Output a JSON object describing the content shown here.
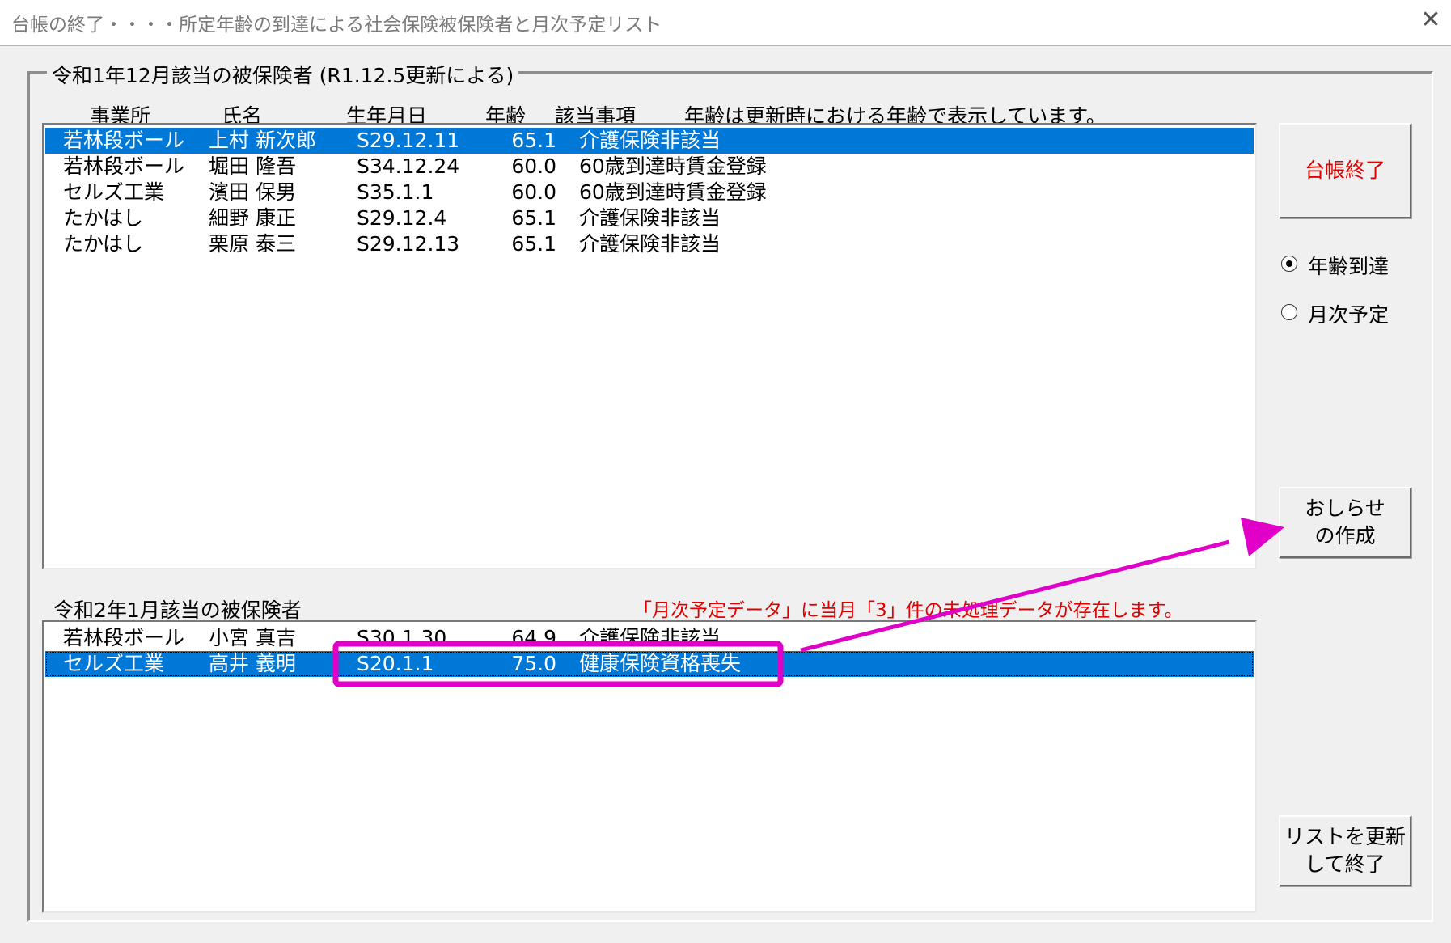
{
  "window": {
    "title": "台帳の終了・・・・所定年齢の到達による社会保険被保険者と月次予定リスト",
    "close_glyph": "✕"
  },
  "group": {
    "legend": "令和1年12月該当の被保険者 (R1.12.5更新による)"
  },
  "headers": {
    "office": "事業所",
    "name": "氏名",
    "birth": "生年月日",
    "age": "年齢",
    "item": "該当事項",
    "note": "年齢は更新時における年齢で表示しています。"
  },
  "list1": {
    "rows": [
      {
        "office": "若林段ボール",
        "name": "上村 新次郎",
        "birth": "S29.12.11",
        "age": "65.1",
        "item": "介護保険非該当"
      },
      {
        "office": "若林段ボール",
        "name": "堀田 隆吾",
        "birth": "S34.12.24",
        "age": "60.0",
        "item": "60歳到達時賃金登録"
      },
      {
        "office": "セルズ工業",
        "name": "濱田 保男",
        "birth": "S35.1.1",
        "age": "60.0",
        "item": "60歳到達時賃金登録"
      },
      {
        "office": "たかはし",
        "name": "細野 康正",
        "birth": "S29.12.4",
        "age": "65.1",
        "item": "介護保険非該当"
      },
      {
        "office": "たかはし",
        "name": "栗原 泰三",
        "birth": "S29.12.13",
        "age": "65.1",
        "item": "介護保険非該当"
      }
    ],
    "selected_index": 0
  },
  "list2": {
    "label": "令和2年1月該当の被保険者",
    "notice": "「月次予定データ」に当月「3」件の未処理データが存在します。",
    "rows": [
      {
        "office": "若林段ボール",
        "name": "小宮 真吉",
        "birth": "S30.1.30",
        "age": "64.9",
        "item": "介護保険非該当"
      },
      {
        "office": "セルズ工業",
        "name": "高井 義明",
        "birth": "S20.1.1",
        "age": "75.0",
        "item": "健康保険資格喪失"
      }
    ],
    "selected_index": 1
  },
  "buttons": {
    "close_ledger": "台帳終了",
    "notice_line1": "おしらせ",
    "notice_line2": "の作成",
    "update_line1": "リストを更新",
    "update_line2": "して終了"
  },
  "radios": {
    "age_reached": "年齢到達",
    "monthly_plan": "月次予定",
    "selected": "age_reached"
  },
  "colors": {
    "selection": "#0078d7",
    "notice_text": "#e00000",
    "close_button_text": "#e00000",
    "annotation": "#e000c8"
  }
}
